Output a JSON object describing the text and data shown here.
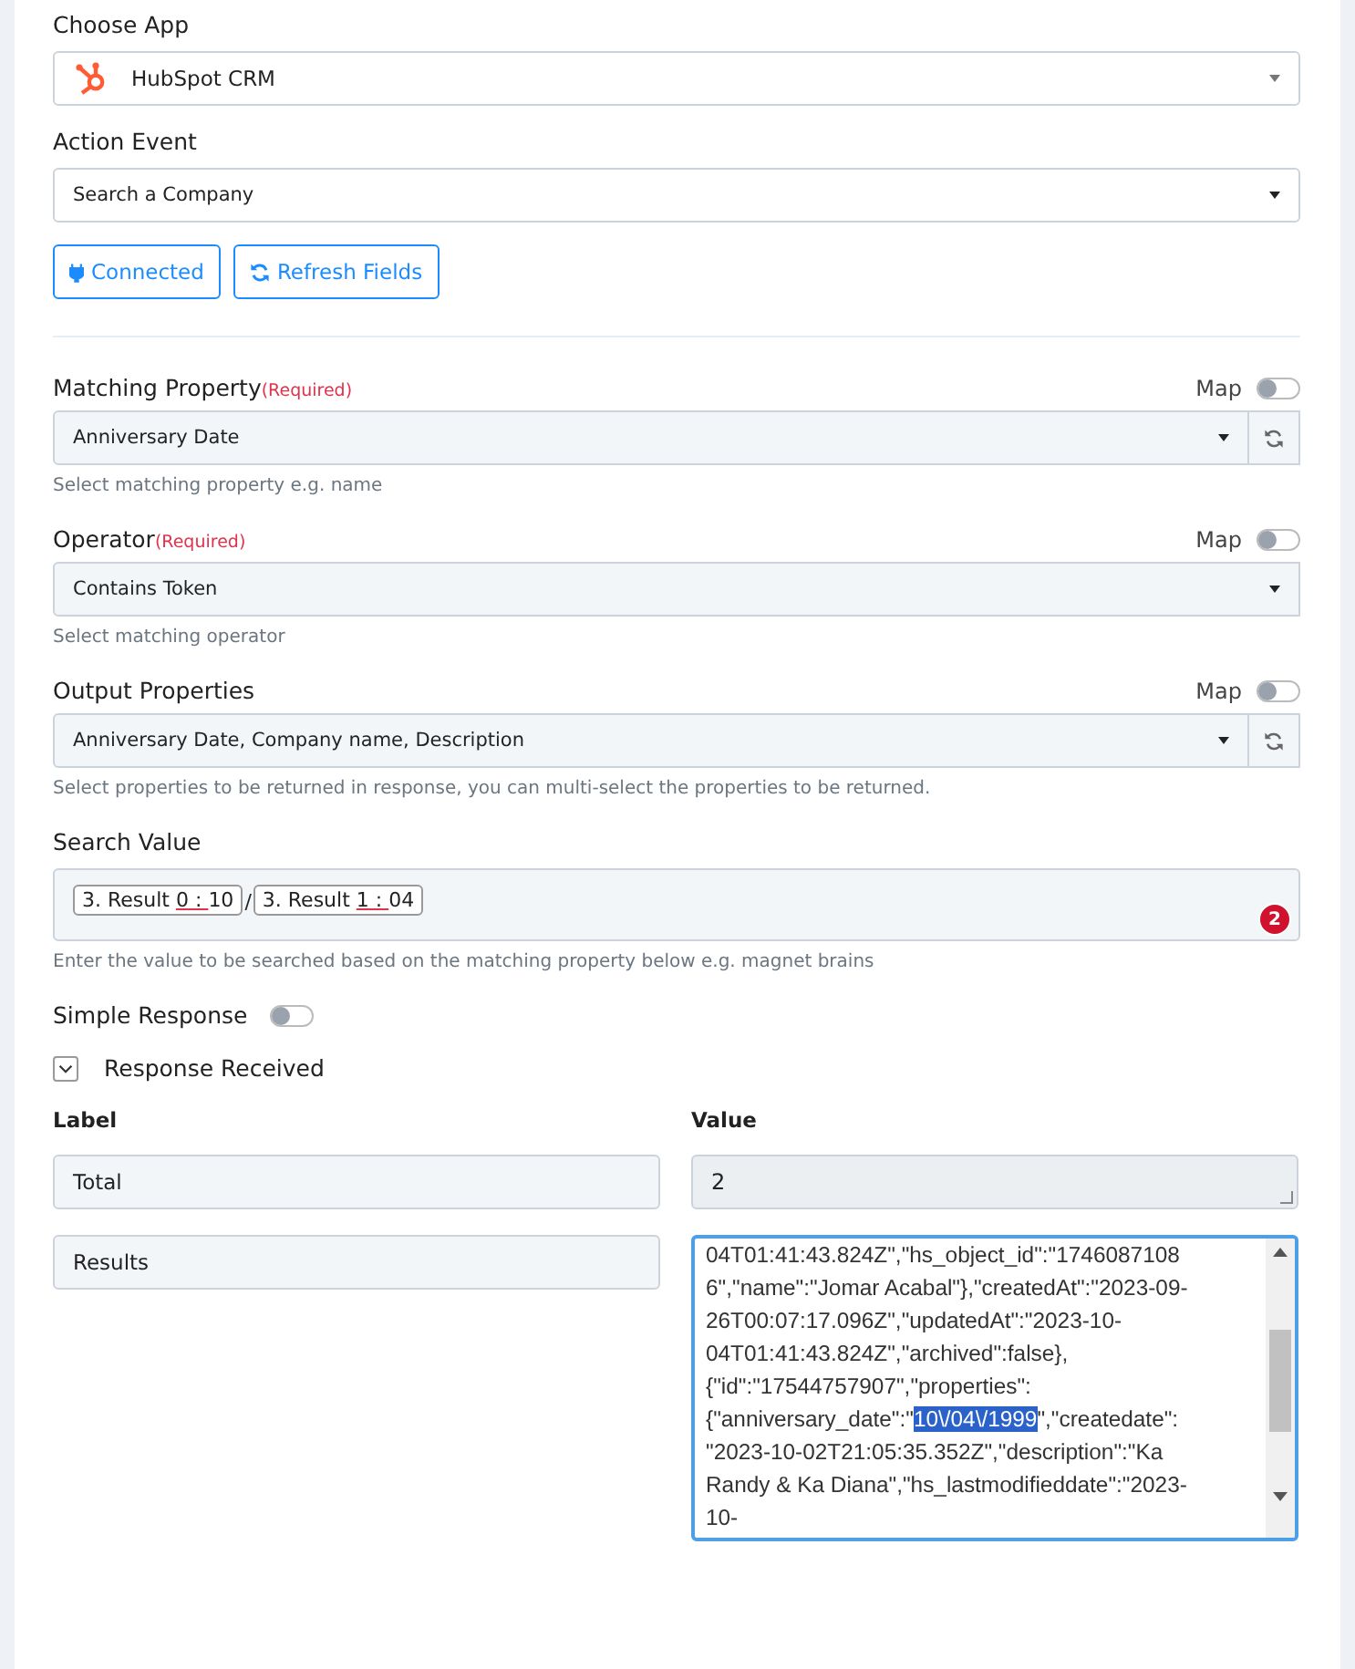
{
  "choose_app": {
    "label": "Choose App",
    "value": "HubSpot CRM"
  },
  "action_event": {
    "label": "Action Event",
    "value": "Search a Company"
  },
  "buttons": [
    {
      "kind": "plug",
      "label": "Connected"
    },
    {
      "kind": "refresh",
      "label": "Refresh Fields"
    }
  ],
  "fields": [
    {
      "label": "Matching Property",
      "required": "(Required)",
      "map_label": "Map",
      "map_on": false,
      "value": "Anniversary Date",
      "refresh": true,
      "hint": "Select matching property e.g. name"
    },
    {
      "label": "Operator",
      "required": "(Required)",
      "map_label": "Map",
      "map_on": false,
      "value": "Contains Token",
      "refresh": false,
      "hint": "Select matching operator"
    },
    {
      "label": "Output Properties",
      "map_label": "Map",
      "map_on": false,
      "value": "Anniversary Date, Company name, Description",
      "refresh": true,
      "hint": "Select properties to be returned in response, you can multi-select the properties to be returned."
    }
  ],
  "search_value": {
    "label": "Search Value",
    "tokens": [
      {
        "prefix": "3. Result ",
        "index": "0 : ",
        "suffix": "10"
      },
      {
        "prefix": "3. Result ",
        "index": "1 : ",
        "suffix": "04"
      }
    ],
    "separator": "/",
    "badge": "2",
    "hint": "Enter the value to be searched based on the matching property below e.g. magnet brains"
  },
  "simple_response": {
    "label": "Simple Response",
    "on": false
  },
  "response_received": {
    "label": "Response Received",
    "expanded": true
  },
  "response_table": {
    "columns": [
      "Label",
      "Value"
    ],
    "rows": [
      {
        "kind": "single",
        "label": "Total",
        "value": "2"
      },
      {
        "kind": "json",
        "label": "Results",
        "lines": [
          {
            "kind": "plain",
            "text": "04T01:41:43.824Z\",\"hs_object_id\":\"1746087108"
          },
          {
            "kind": "plain",
            "text": "6\",\"name\":\"Jomar Acabal\"},\"createdAt\":\"2023-09-"
          },
          {
            "kind": "plain",
            "text": "26T00:07:17.096Z\",\"updatedAt\":\"2023-10-"
          },
          {
            "kind": "plain",
            "text": "04T01:41:43.824Z\",\"archived\":false},"
          },
          {
            "kind": "plain",
            "text": "{\"id\":\"17544757907\",\"properties\":"
          },
          {
            "kind": "selection",
            "before": "{\"anniversary_date\":\"",
            "selected": "10\\/04\\/1999",
            "after": "\",\"createdate\":"
          },
          {
            "kind": "plain",
            "text": "\"2023-10-02T21:05:35.352Z\",\"description\":\"Ka"
          },
          {
            "kind": "plain",
            "text": "Randy & Ka Diana\",\"hs_lastmodifieddate\":\"2023-"
          },
          {
            "kind": "plain",
            "text": "10-"
          }
        ]
      }
    ]
  }
}
